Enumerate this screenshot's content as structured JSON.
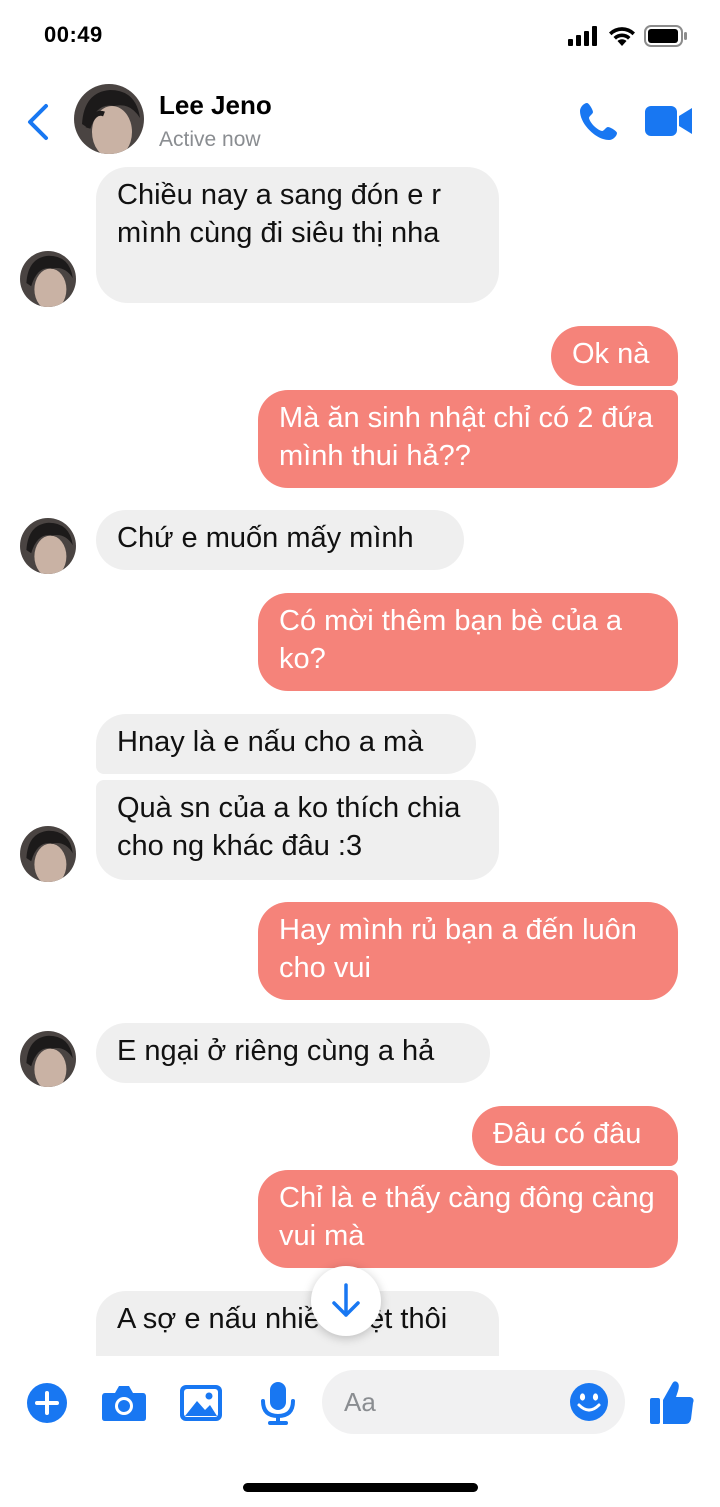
{
  "status_bar": {
    "time": "00:49"
  },
  "header": {
    "name": "Lee Jeno",
    "status": "Active now"
  },
  "messages": [
    {
      "from": "them",
      "text": "Chiều nay a sang đón e r mình cùng đi siêu thị nha"
    },
    {
      "from": "me",
      "text": "Ok nà"
    },
    {
      "from": "me",
      "text": "Mà ăn sinh nhật chỉ có 2 đứa mình thui hả??"
    },
    {
      "from": "them",
      "text": "Chứ e muốn mấy mình"
    },
    {
      "from": "me",
      "text": "Có mời thêm bạn bè của a ko?"
    },
    {
      "from": "them",
      "text": "Hnay là e nấu cho a mà"
    },
    {
      "from": "them",
      "text": "Quà sn của a ko thích chia cho ng khác đâu :3"
    },
    {
      "from": "me",
      "text": "Hay mình rủ bạn a đến luôn cho vui"
    },
    {
      "from": "them",
      "text": "E ngại ở riêng cùng a hả"
    },
    {
      "from": "me",
      "text": "Đâu có đâu"
    },
    {
      "from": "me",
      "text": "Chỉ là e thấy càng đông càng vui mà"
    },
    {
      "from": "them",
      "text": "A sợ e nấu nhiều mệt thôi"
    }
  ],
  "composer": {
    "placeholder": "Aa"
  },
  "colors": {
    "accent": "#1877f2",
    "outgoing": "#f5837a",
    "incoming": "#efefef"
  },
  "icons": [
    "back-chevron-icon",
    "phone-icon",
    "video-camera-icon",
    "plus-icon",
    "camera-icon",
    "image-icon",
    "microphone-icon",
    "emoji-icon",
    "thumbs-up-icon",
    "arrow-down-icon"
  ]
}
